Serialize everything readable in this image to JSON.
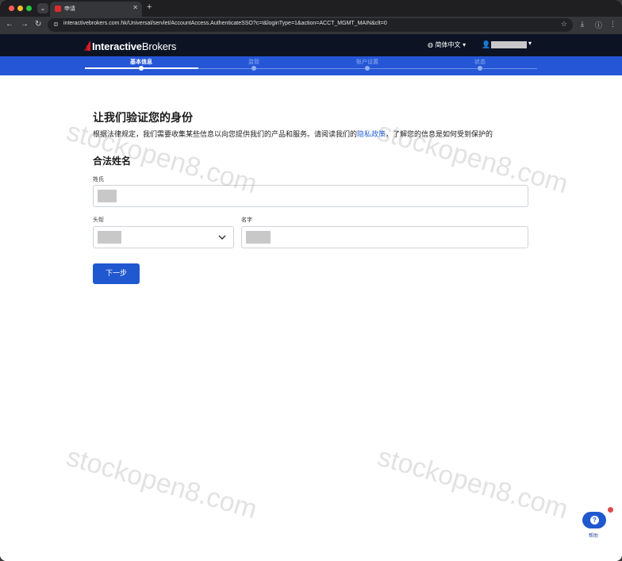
{
  "browser": {
    "tab_title": "申请",
    "url": "interactivebrokers.com.hk/Universal/servlet/AccountAccess.AuthenticateSSO?c=t&loginType=1&action=ACCT_MGMT_MAIN&clt=0"
  },
  "site": {
    "brand_bold": "Interactive",
    "brand_light": "Brokers",
    "language": "简体中文",
    "language_caret": "▾",
    "user_caret": "▾"
  },
  "steps": [
    {
      "label": "基本信息",
      "state": "active"
    },
    {
      "label": "监管",
      "state": "pending"
    },
    {
      "label": "账户设置",
      "state": "pending"
    },
    {
      "label": "状态",
      "state": "pending"
    }
  ],
  "form": {
    "title": "让我们验证您的身份",
    "desc_before": "根据法律规定，我们需要收集某些信息以向您提供我们的产品和服务。请阅读我们的",
    "privacy_link": "隐私政策",
    "desc_after": "，了解您的信息是如何受到保护的",
    "section_title": "合法姓名",
    "last_name_label": "姓氏",
    "title_label": "头衔",
    "first_name_label": "名字",
    "next_button": "下一步"
  },
  "watermark": "stockopen8.com",
  "help": {
    "label": "帮助",
    "glyph": "?"
  },
  "colors": {
    "header_bg": "#0c1424",
    "progress_bg": "#2556d6",
    "primary_button": "#1f58cf",
    "link": "#2b63d9"
  }
}
